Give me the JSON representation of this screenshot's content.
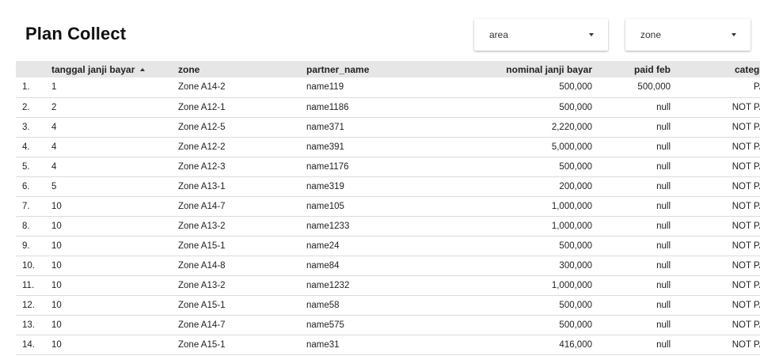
{
  "page": {
    "title": "Plan Collect"
  },
  "filters": {
    "area": {
      "label": "area"
    },
    "zone": {
      "label": "zone"
    }
  },
  "table": {
    "columns": [
      "tanggal janji bayar",
      "zone",
      "partner_name",
      "nominal janji bayar",
      "paid feb",
      "category"
    ],
    "sort": {
      "column": "tanggal janji bayar",
      "direction": "ascending",
      "icon": "sort-ascending-icon"
    },
    "rows": [
      {
        "idx": "1.",
        "tanggal": "1",
        "zone": "Zone A14-2",
        "partner": "name119",
        "nominal": "500,000",
        "paid": "500,000",
        "category": "PAID"
      },
      {
        "idx": "2.",
        "tanggal": "2",
        "zone": "Zone A12-1",
        "partner": "name1186",
        "nominal": "500,000",
        "paid": "null",
        "category": "NOT PAID"
      },
      {
        "idx": "3.",
        "tanggal": "4",
        "zone": "Zone A12-5",
        "partner": "name371",
        "nominal": "2,220,000",
        "paid": "null",
        "category": "NOT PAID"
      },
      {
        "idx": "4.",
        "tanggal": "4",
        "zone": "Zone A12-2",
        "partner": "name391",
        "nominal": "5,000,000",
        "paid": "null",
        "category": "NOT PAID"
      },
      {
        "idx": "5.",
        "tanggal": "4",
        "zone": "Zone A12-3",
        "partner": "name1176",
        "nominal": "500,000",
        "paid": "null",
        "category": "NOT PAID"
      },
      {
        "idx": "6.",
        "tanggal": "5",
        "zone": "Zone A13-1",
        "partner": "name319",
        "nominal": "200,000",
        "paid": "null",
        "category": "NOT PAID"
      },
      {
        "idx": "7.",
        "tanggal": "10",
        "zone": "Zone A14-7",
        "partner": "name105",
        "nominal": "1,000,000",
        "paid": "null",
        "category": "NOT PAID"
      },
      {
        "idx": "8.",
        "tanggal": "10",
        "zone": "Zone A13-2",
        "partner": "name1233",
        "nominal": "1,000,000",
        "paid": "null",
        "category": "NOT PAID"
      },
      {
        "idx": "9.",
        "tanggal": "10",
        "zone": "Zone A15-1",
        "partner": "name24",
        "nominal": "500,000",
        "paid": "null",
        "category": "NOT PAID"
      },
      {
        "idx": "10.",
        "tanggal": "10",
        "zone": "Zone A14-8",
        "partner": "name84",
        "nominal": "300,000",
        "paid": "null",
        "category": "NOT PAID"
      },
      {
        "idx": "11.",
        "tanggal": "10",
        "zone": "Zone A13-2",
        "partner": "name1232",
        "nominal": "1,000,000",
        "paid": "null",
        "category": "NOT PAID"
      },
      {
        "idx": "12.",
        "tanggal": "10",
        "zone": "Zone A15-1",
        "partner": "name58",
        "nominal": "500,000",
        "paid": "null",
        "category": "NOT PAID"
      },
      {
        "idx": "13.",
        "tanggal": "10",
        "zone": "Zone A14-7",
        "partner": "name575",
        "nominal": "500,000",
        "paid": "null",
        "category": "NOT PAID"
      },
      {
        "idx": "14.",
        "tanggal": "10",
        "zone": "Zone A15-1",
        "partner": "name31",
        "nominal": "416,000",
        "paid": "null",
        "category": "NOT PAID"
      }
    ]
  }
}
